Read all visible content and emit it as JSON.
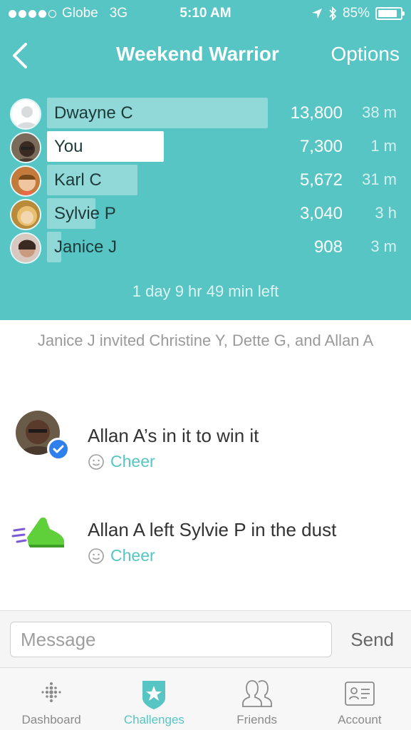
{
  "status": {
    "carrier": "Globe",
    "network": "3G",
    "time": "5:10 AM",
    "battery": "85%",
    "battery_fraction": 0.85
  },
  "nav": {
    "title": "Weekend Warrior",
    "options": "Options"
  },
  "leaderboard": [
    {
      "name": "Dwayne C",
      "steps": "13,800",
      "ago": "38 m",
      "fraction": 1.0,
      "is_me": false
    },
    {
      "name": "You",
      "steps": "7,300",
      "ago": "1 m",
      "fraction": 0.529,
      "is_me": true
    },
    {
      "name": "Karl C",
      "steps": "5,672",
      "ago": "31 m",
      "fraction": 0.411,
      "is_me": false
    },
    {
      "name": "Sylvie P",
      "steps": "3,040",
      "ago": "3 h",
      "fraction": 0.22,
      "is_me": false
    },
    {
      "name": "Janice J",
      "steps": "908",
      "ago": "3 m",
      "fraction": 0.066,
      "is_me": false
    }
  ],
  "time_left": "1 day 9 hr 49 min left",
  "invite_text": "Janice J invited Christine Y, Dette G, and Allan A",
  "feed": [
    {
      "title": "Allan A’s in it to win it",
      "cheer": "Cheer"
    },
    {
      "title": "Allan A left Sylvie P in the dust",
      "cheer": "Cheer"
    }
  ],
  "message": {
    "placeholder": "Message",
    "send": "Send"
  },
  "tabs": [
    {
      "label": "Dashboard",
      "icon": "dashboard-dots-icon",
      "active": false
    },
    {
      "label": "Challenges",
      "icon": "star-badge-icon",
      "active": true
    },
    {
      "label": "Friends",
      "icon": "friends-icon",
      "active": false
    },
    {
      "label": "Account",
      "icon": "account-card-icon",
      "active": false
    }
  ],
  "colors": {
    "accent": "#56c5c3",
    "verified": "#2f80ed",
    "shoe": "#5fcf3a"
  }
}
